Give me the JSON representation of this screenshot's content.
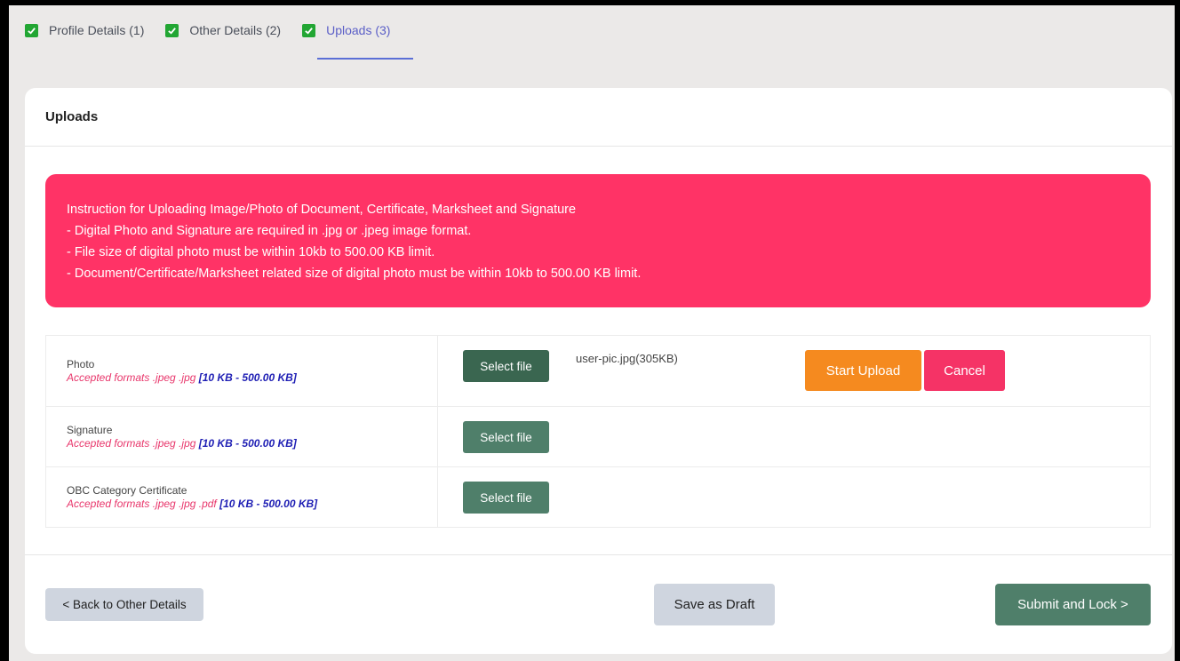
{
  "tabs": [
    {
      "label": "Profile Details  (1)",
      "checked": true
    },
    {
      "label": "Other Details  (2)",
      "checked": true
    },
    {
      "label": "Uploads  (3)",
      "checked": true,
      "active": true
    }
  ],
  "card": {
    "title": "Uploads"
  },
  "instructions": {
    "heading": "Instruction for Uploading Image/Photo of Document, Certificate, Marksheet and Signature",
    "lines": [
      "- Digital Photo and Signature are required in .jpg or .jpeg image format.",
      "- File size of digital photo must be within 10kb to 500.00 KB limit.",
      "- Document/Certificate/Marksheet related size of digital photo must be within 10kb to 500.00 KB limit."
    ]
  },
  "uploads": [
    {
      "name": "Photo",
      "formats": "Accepted formats .jpeg .jpg ",
      "limit": "[10 KB - 500.00 KB]",
      "select_label": "Select file",
      "file": "user-pic.jpg(305KB)",
      "start_label": "Start Upload",
      "cancel_label": "Cancel"
    },
    {
      "name": "Signature",
      "formats": "Accepted formats .jpeg .jpg ",
      "limit": "[10 KB - 500.00 KB]",
      "select_label": "Select file"
    },
    {
      "name": "OBC Category Certificate",
      "formats": "Accepted formats .jpeg .jpg .pdf ",
      "limit": "[10 KB - 500.00 KB]",
      "select_label": "Select file"
    }
  ],
  "footer": {
    "back_label": "< Back to Other Details",
    "draft_label": "Save as Draft",
    "submit_label": "Submit and Lock >"
  },
  "colors": {
    "alert": "#ff3366",
    "check": "#22a633",
    "primary": "#4f7f6a",
    "start": "#f58a1f",
    "cancel": "#f53366",
    "active_tab": "#5b5fc7"
  },
  "icons": {
    "tab_check": "checkbox-checked-icon"
  }
}
